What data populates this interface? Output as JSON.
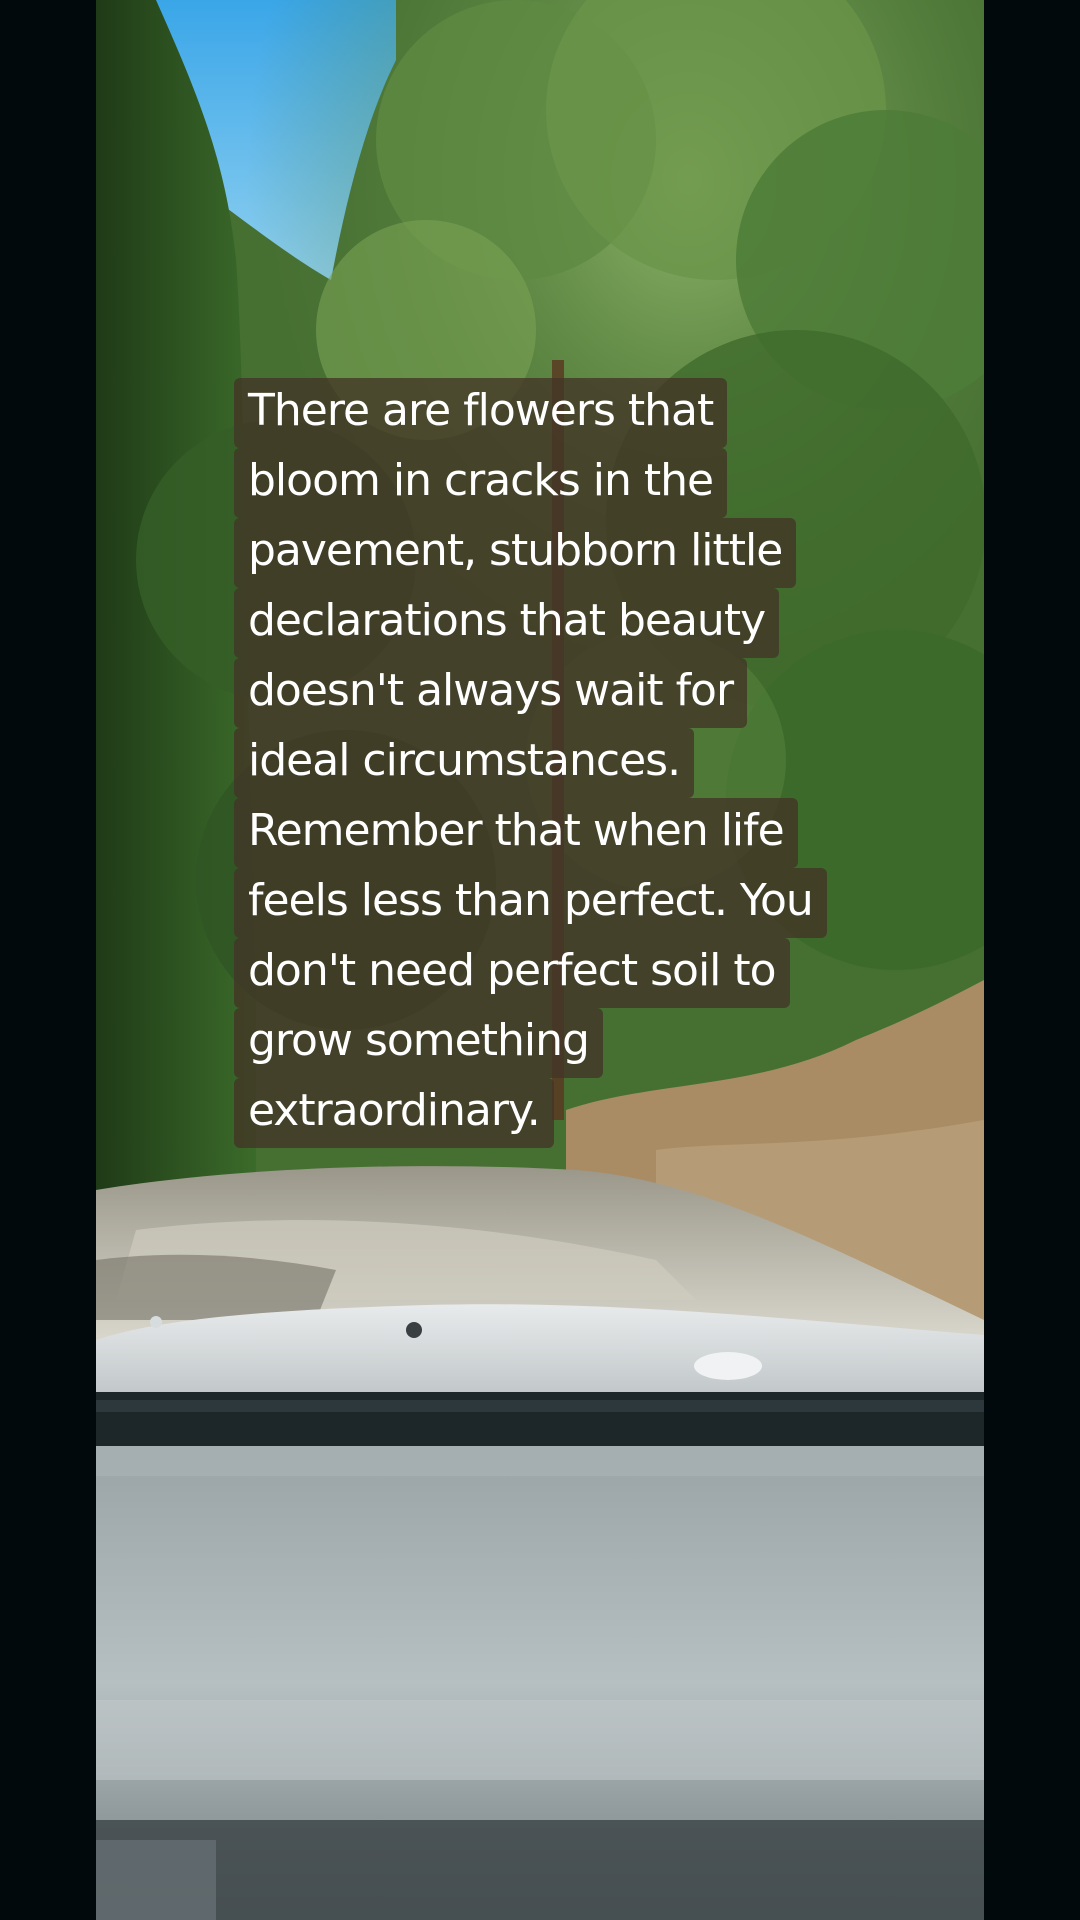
{
  "caption": {
    "lines": [
      "There are flowers that",
      "bloom in cracks in the",
      "pavement, stubborn little",
      "declarations that beauty",
      "doesn't always wait for",
      "ideal circumstances.",
      "Remember that when life",
      "feels less than perfect. You",
      "don't need perfect soil to",
      "grow something",
      "extraordinary."
    ]
  },
  "colors": {
    "letterbox": "#02090c",
    "sky": "#4fb0e6",
    "foliage": "#3f6a2e",
    "road": "#b9b6a6",
    "dashboard": "#8d979a",
    "caption_background": "#423426",
    "caption_text": "#ffffff"
  }
}
